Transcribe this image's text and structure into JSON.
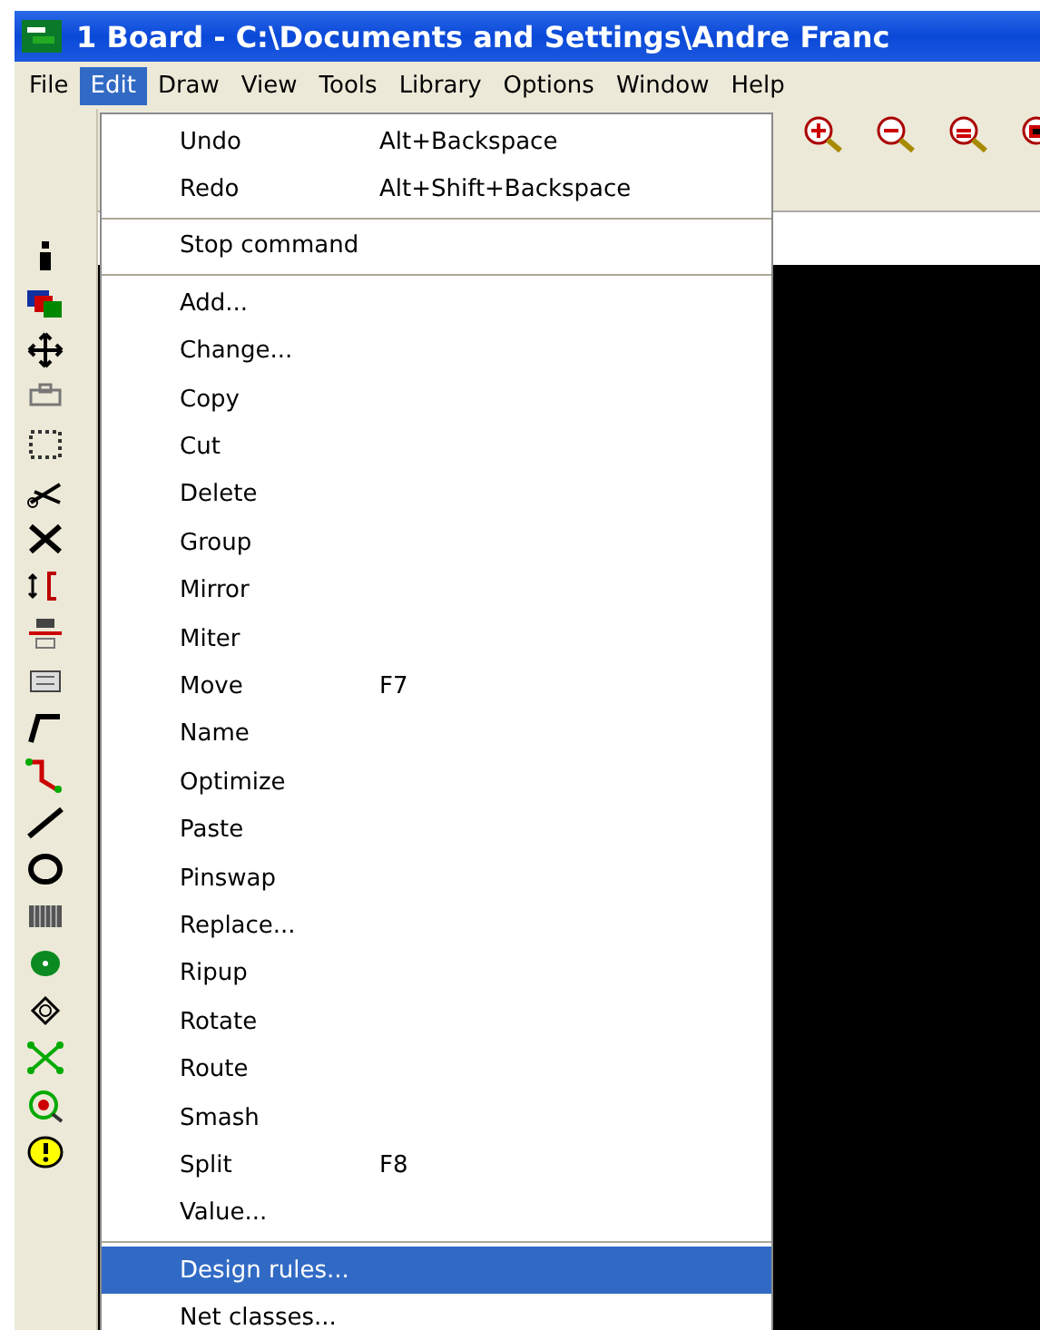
{
  "window": {
    "title": "1 Board - C:\\Documents and Settings\\Andre Franc"
  },
  "menubar": [
    {
      "label": "File",
      "selected": false
    },
    {
      "label": "Edit",
      "selected": true
    },
    {
      "label": "Draw",
      "selected": false
    },
    {
      "label": "View",
      "selected": false
    },
    {
      "label": "Tools",
      "selected": false
    },
    {
      "label": "Library",
      "selected": false
    },
    {
      "label": "Options",
      "selected": false
    },
    {
      "label": "Window",
      "selected": false
    },
    {
      "label": "Help",
      "selected": false
    }
  ],
  "edit_menu": [
    {
      "kind": "item",
      "label": "Undo",
      "shortcut": "Alt+Backspace",
      "selected": false
    },
    {
      "kind": "item",
      "label": "Redo",
      "shortcut": "Alt+Shift+Backspace",
      "selected": false
    },
    {
      "kind": "separator"
    },
    {
      "kind": "item",
      "label": "Stop command",
      "selected": false
    },
    {
      "kind": "separator"
    },
    {
      "kind": "item",
      "label": "Add...",
      "selected": false
    },
    {
      "kind": "item",
      "label": "Change...",
      "selected": false
    },
    {
      "kind": "item",
      "label": "Copy",
      "selected": false
    },
    {
      "kind": "item",
      "label": "Cut",
      "selected": false
    },
    {
      "kind": "item",
      "label": "Delete",
      "selected": false
    },
    {
      "kind": "item",
      "label": "Group",
      "selected": false
    },
    {
      "kind": "item",
      "label": "Mirror",
      "selected": false
    },
    {
      "kind": "item",
      "label": "Miter",
      "selected": false
    },
    {
      "kind": "item",
      "label": "Move",
      "shortcut": "F7",
      "selected": false
    },
    {
      "kind": "item",
      "label": "Name",
      "selected": false
    },
    {
      "kind": "item",
      "label": "Optimize",
      "selected": false
    },
    {
      "kind": "item",
      "label": "Paste",
      "selected": false
    },
    {
      "kind": "item",
      "label": "Pinswap",
      "selected": false
    },
    {
      "kind": "item",
      "label": "Replace...",
      "selected": false
    },
    {
      "kind": "item",
      "label": "Ripup",
      "selected": false
    },
    {
      "kind": "item",
      "label": "Rotate",
      "selected": false
    },
    {
      "kind": "item",
      "label": "Route",
      "selected": false
    },
    {
      "kind": "item",
      "label": "Smash",
      "selected": false
    },
    {
      "kind": "item",
      "label": "Split",
      "shortcut": "F8",
      "selected": false
    },
    {
      "kind": "item",
      "label": "Value...",
      "selected": false
    },
    {
      "kind": "separator"
    },
    {
      "kind": "item",
      "label": "Design rules...",
      "selected": true
    },
    {
      "kind": "item",
      "label": "Net classes...",
      "selected": false
    }
  ]
}
